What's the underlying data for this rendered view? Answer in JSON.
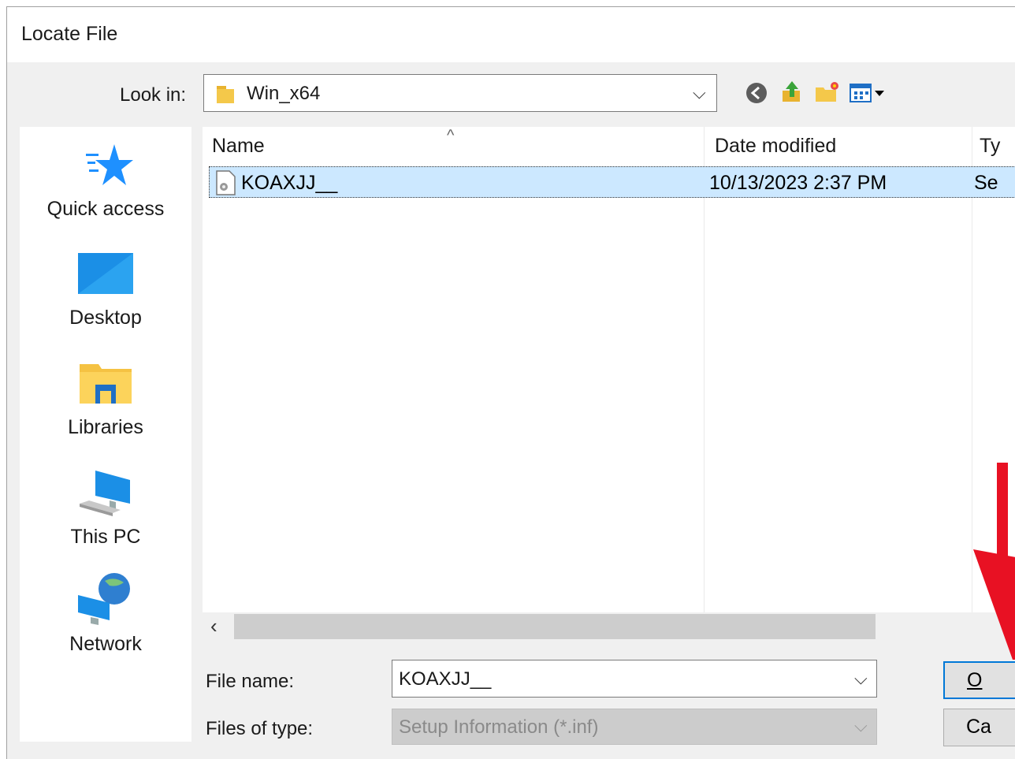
{
  "dialog": {
    "title": "Locate File",
    "look_in_label": "Look in:",
    "look_in_value": "Win_x64",
    "places": [
      "Quick access",
      "Desktop",
      "Libraries",
      "This PC",
      "Network"
    ],
    "columns": {
      "name": "Name",
      "date": "Date modified",
      "type": "Ty"
    },
    "files": [
      {
        "name": "KOAXJJ__",
        "date": "10/13/2023 2:37 PM",
        "type": "Se"
      }
    ],
    "file_name_label": "File name:",
    "file_name_value": "KOAXJJ__",
    "file_type_label": "Files of type:",
    "file_type_value": "Setup Information (*.inf)",
    "open_button": "O",
    "cancel_button": "Ca"
  },
  "colors": {
    "selection": "#cce8ff",
    "open_button_border": "#0078d7",
    "annotation_arrow": "#e81123"
  },
  "icons": [
    "folder-icon",
    "back-icon",
    "up-folder-icon",
    "new-folder-icon",
    "view-menu-icon",
    "file-icon",
    "star-icon",
    "desktop-icon",
    "libraries-icon",
    "pc-icon",
    "network-icon"
  ]
}
